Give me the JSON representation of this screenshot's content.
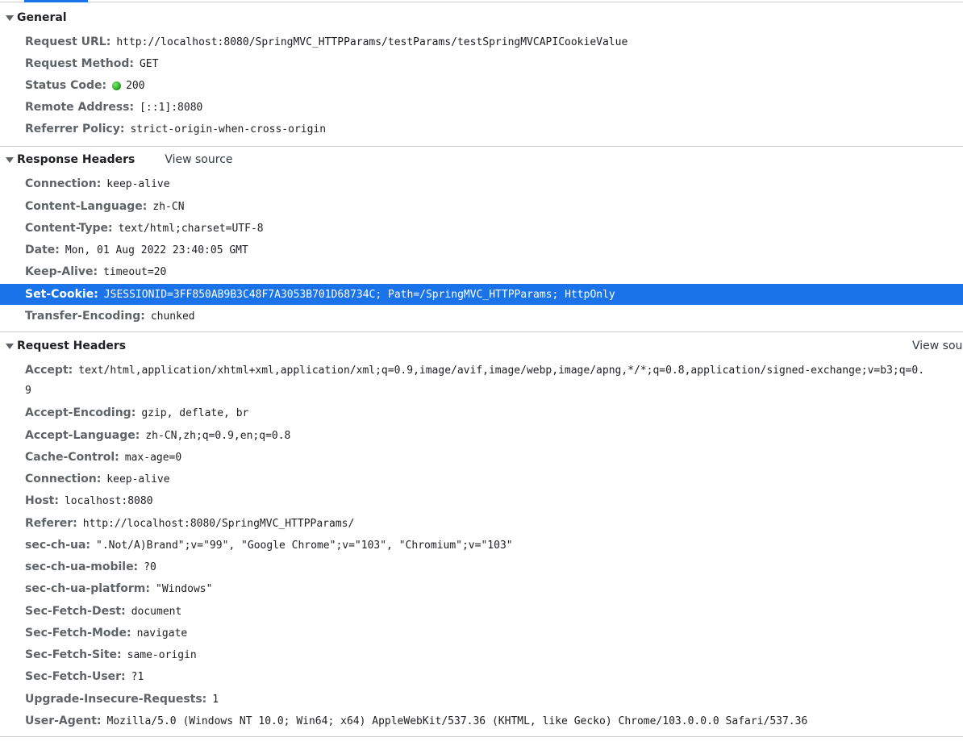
{
  "general": {
    "title": "General",
    "rows": [
      {
        "key": "Request URL:",
        "value": "http://localhost:8080/SpringMVC_HTTPParams/testParams/testSpringMVCAPICookieValue"
      },
      {
        "key": "Request Method:",
        "value": "GET"
      },
      {
        "key": "Status Code:",
        "value": "200",
        "status_color": "#1e9e1e"
      },
      {
        "key": "Remote Address:",
        "value": "[::1]:8080"
      },
      {
        "key": "Referrer Policy:",
        "value": "strict-origin-when-cross-origin"
      }
    ]
  },
  "response_headers": {
    "title": "Response Headers",
    "view_source": "View source",
    "rows": [
      {
        "key": "Connection:",
        "value": "keep-alive"
      },
      {
        "key": "Content-Language:",
        "value": "zh-CN"
      },
      {
        "key": "Content-Type:",
        "value": "text/html;charset=UTF-8"
      },
      {
        "key": "Date:",
        "value": "Mon, 01 Aug 2022 23:40:05 GMT"
      },
      {
        "key": "Keep-Alive:",
        "value": "timeout=20"
      },
      {
        "key": "Set-Cookie:",
        "value": "JSESSIONID=3FF850AB9B3C48F7A3053B701D68734C; Path=/SpringMVC_HTTPParams; HttpOnly",
        "selected": true
      },
      {
        "key": "Transfer-Encoding:",
        "value": "chunked"
      }
    ]
  },
  "request_headers": {
    "title": "Request Headers",
    "view_source": "View sour",
    "accept": {
      "key": "Accept:",
      "value": "text/html,application/xhtml+xml,application/xml;q=0.9,image/avif,image/webp,image/apng,*/*;q=0.8,application/signed-exchange;v=b3;q=0.",
      "wrap": "9"
    },
    "rows": [
      {
        "key": "Accept-Encoding:",
        "value": "gzip, deflate, br"
      },
      {
        "key": "Accept-Language:",
        "value": "zh-CN,zh;q=0.9,en;q=0.8"
      },
      {
        "key": "Cache-Control:",
        "value": "max-age=0"
      },
      {
        "key": "Connection:",
        "value": "keep-alive"
      },
      {
        "key": "Host:",
        "value": "localhost:8080"
      },
      {
        "key": "Referer:",
        "value": "http://localhost:8080/SpringMVC_HTTPParams/"
      },
      {
        "key": "sec-ch-ua:",
        "value": "\".Not/A)Brand\";v=\"99\", \"Google Chrome\";v=\"103\", \"Chromium\";v=\"103\""
      },
      {
        "key": "sec-ch-ua-mobile:",
        "value": "?0"
      },
      {
        "key": "sec-ch-ua-platform:",
        "value": "\"Windows\""
      },
      {
        "key": "Sec-Fetch-Dest:",
        "value": "document"
      },
      {
        "key": "Sec-Fetch-Mode:",
        "value": "navigate"
      },
      {
        "key": "Sec-Fetch-Site:",
        "value": "same-origin"
      },
      {
        "key": "Sec-Fetch-User:",
        "value": "?1"
      },
      {
        "key": "Upgrade-Insecure-Requests:",
        "value": "1"
      },
      {
        "key": "User-Agent:",
        "value": "Mozilla/5.0 (Windows NT 10.0; Win64; x64) AppleWebKit/537.36 (KHTML, like Gecko) Chrome/103.0.0.0 Safari/537.36"
      }
    ]
  },
  "colors": {
    "accent": "#1a73e8",
    "selected_text": "#ffffff",
    "divider": "#cacdd1"
  }
}
